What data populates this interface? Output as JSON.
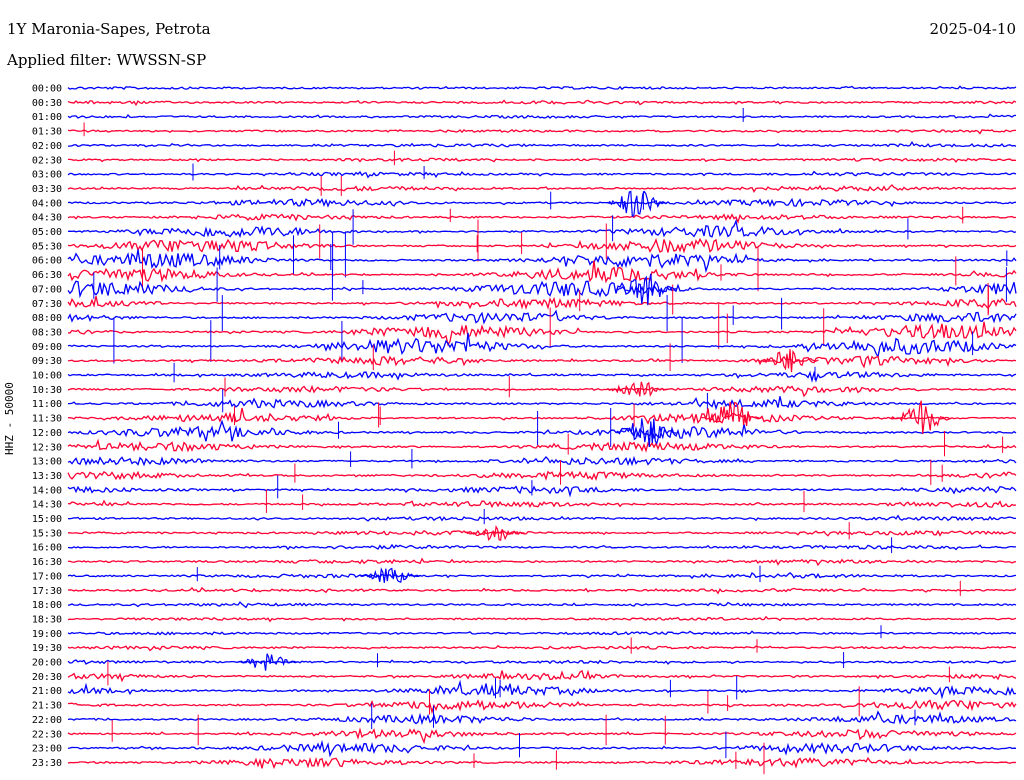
{
  "header": {
    "station": "1Y Maronia-Sapes, Petrota",
    "filter": "Applied filter: WWSSN-SP",
    "date": "2025-04-10",
    "channel_label": "HHZ - 50000"
  },
  "colors": {
    "odd_row": "#0000ff",
    "even_row": "#ff0033",
    "background": "#ffffff"
  },
  "chart_data": {
    "type": "line",
    "title": "1Y Maronia-Sapes, Petrota",
    "subtitle": "Applied filter: WWSSN-SP",
    "ylabel": "HHZ - 50000",
    "row_labels": [
      "00:00",
      "00:30",
      "01:00",
      "01:30",
      "02:00",
      "02:30",
      "03:00",
      "03:30",
      "04:00",
      "04:30",
      "05:00",
      "05:30",
      "06:00",
      "06:30",
      "07:00",
      "07:30",
      "08:00",
      "08:30",
      "09:00",
      "09:30",
      "10:00",
      "10:30",
      "11:00",
      "11:30",
      "12:00",
      "12:30",
      "13:00",
      "13:30",
      "14:00",
      "14:30",
      "15:00",
      "15:30",
      "16:00",
      "16:30",
      "17:00",
      "17:30",
      "18:00",
      "18:30",
      "19:00",
      "19:30",
      "20:00",
      "20:30",
      "21:00",
      "21:30",
      "22:00",
      "22:30",
      "23:00",
      "23:30"
    ],
    "row_minutes": 30,
    "series_colors_alternate": [
      "#0000ff",
      "#ff0033"
    ],
    "activity_level": [
      0.05,
      0.08,
      0.06,
      0.05,
      0.08,
      0.07,
      0.1,
      0.18,
      0.3,
      0.22,
      0.55,
      0.7,
      0.75,
      0.7,
      0.8,
      0.45,
      0.5,
      0.7,
      0.8,
      0.4,
      0.25,
      0.25,
      0.35,
      0.45,
      0.55,
      0.4,
      0.35,
      0.35,
      0.3,
      0.25,
      0.12,
      0.15,
      0.12,
      0.12,
      0.12,
      0.08,
      0.06,
      0.06,
      0.06,
      0.08,
      0.08,
      0.25,
      0.45,
      0.45,
      0.4,
      0.4,
      0.45,
      0.4
    ],
    "events": [
      {
        "row": 8,
        "time_fraction": 0.6,
        "amplitude": 0.9,
        "color": "#0000ff"
      },
      {
        "row": 14,
        "time_fraction": 0.61,
        "amplitude": 1.0,
        "color": "#0000ff"
      },
      {
        "row": 19,
        "time_fraction": 0.76,
        "amplitude": 0.7,
        "color": "#ff0033"
      },
      {
        "row": 21,
        "time_fraction": 0.6,
        "amplitude": 0.6,
        "color": "#ff0033"
      },
      {
        "row": 23,
        "time_fraction": 0.7,
        "amplitude": 1.0,
        "color": "#ff0033"
      },
      {
        "row": 23,
        "time_fraction": 0.9,
        "amplitude": 1.0,
        "color": "#ff0033"
      },
      {
        "row": 24,
        "time_fraction": 0.61,
        "amplitude": 1.0,
        "color": "#0000ff"
      },
      {
        "row": 31,
        "time_fraction": 0.45,
        "amplitude": 0.5,
        "color": "#ff0033"
      },
      {
        "row": 34,
        "time_fraction": 0.34,
        "amplitude": 0.5,
        "color": "#0000ff"
      },
      {
        "row": 40,
        "time_fraction": 0.21,
        "amplitude": 0.5,
        "color": "#0000ff"
      }
    ]
  }
}
